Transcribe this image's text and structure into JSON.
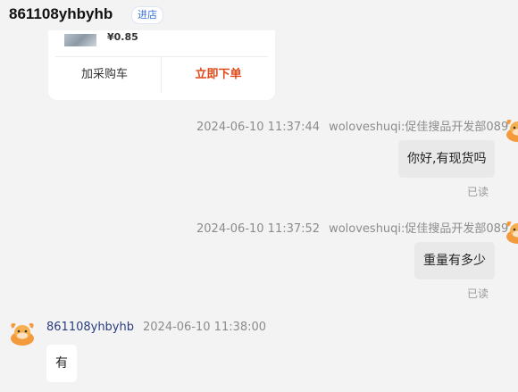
{
  "header": {
    "shop_name": "861108yhbyhb",
    "enter_shop": "进店"
  },
  "product_card": {
    "price_peek": "¥0.85",
    "add_to_cart": "加采购车",
    "buy_now": "立即下单"
  },
  "messages": [
    {
      "time": "2024-06-10 11:37:44",
      "sender": "woloveshuqi:促佳搜品开发部089",
      "text": "你好,有现货吗",
      "status": "已读"
    },
    {
      "time": "2024-06-10 11:37:52",
      "sender": "woloveshuqi:促佳搜品开发部089",
      "text": "重量有多少",
      "status": "已读"
    },
    {
      "time": "2024-06-10 11:38:00",
      "sender": "861108yhbyhb",
      "text": "有"
    }
  ],
  "colors": {
    "accent_orange": "#e0491a",
    "link_blue": "#3a6fd8",
    "sender_name": "#2a3d7c"
  }
}
